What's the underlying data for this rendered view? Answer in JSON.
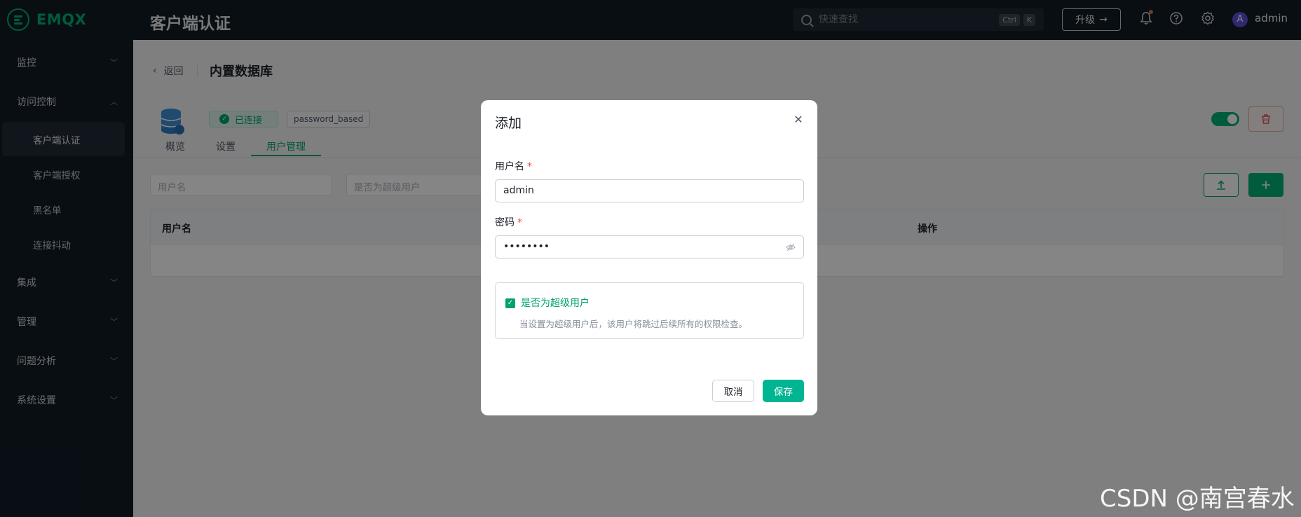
{
  "app": {
    "logo_text": "EMQX",
    "page_title": "客户端认证"
  },
  "header": {
    "search_placeholder": "快速查找",
    "shortcut_keys": [
      "Ctrl",
      "K"
    ],
    "upgrade_label": "升级",
    "user": {
      "avatar_letter": "A",
      "name": "admin"
    }
  },
  "sidebar": {
    "items": [
      {
        "label": "监控",
        "expanded": false
      },
      {
        "label": "访问控制",
        "expanded": true
      },
      {
        "label": "集成",
        "expanded": false
      },
      {
        "label": "管理",
        "expanded": false
      },
      {
        "label": "问题分析",
        "expanded": false
      },
      {
        "label": "系统设置",
        "expanded": false
      }
    ],
    "sub_items": [
      {
        "label": "客户端认证",
        "active": true
      },
      {
        "label": "客户端授权",
        "active": false
      },
      {
        "label": "黑名单",
        "active": false
      },
      {
        "label": "连接抖动",
        "active": false
      }
    ]
  },
  "main": {
    "back_label": "返回",
    "title": "内置数据库",
    "status": "已连接",
    "mechanism": "password_based",
    "enabled": true,
    "tabs": [
      {
        "label": "概览",
        "active": false
      },
      {
        "label": "设置",
        "active": false
      },
      {
        "label": "用户管理",
        "active": true
      }
    ],
    "filters": {
      "username_placeholder": "用户名",
      "superuser_placeholder": "是否为超级用户"
    },
    "table": {
      "columns": [
        "用户名",
        "操作"
      ]
    }
  },
  "modal": {
    "title": "添加",
    "username_label": "用户名",
    "username_value": "admin",
    "password_label": "密码",
    "password_value": "••••••••",
    "superuser_label": "是否为超级用户",
    "superuser_checked": true,
    "superuser_desc": "当设置为超级用户后，该用户将跳过后续所有的权限检查。",
    "cancel_label": "取消",
    "save_label": "保存"
  },
  "watermark": "CSDN @南宫春水",
  "colors": {
    "accent": "#00b173",
    "danger": "#e05252",
    "sidebar_bg": "#101b24"
  }
}
